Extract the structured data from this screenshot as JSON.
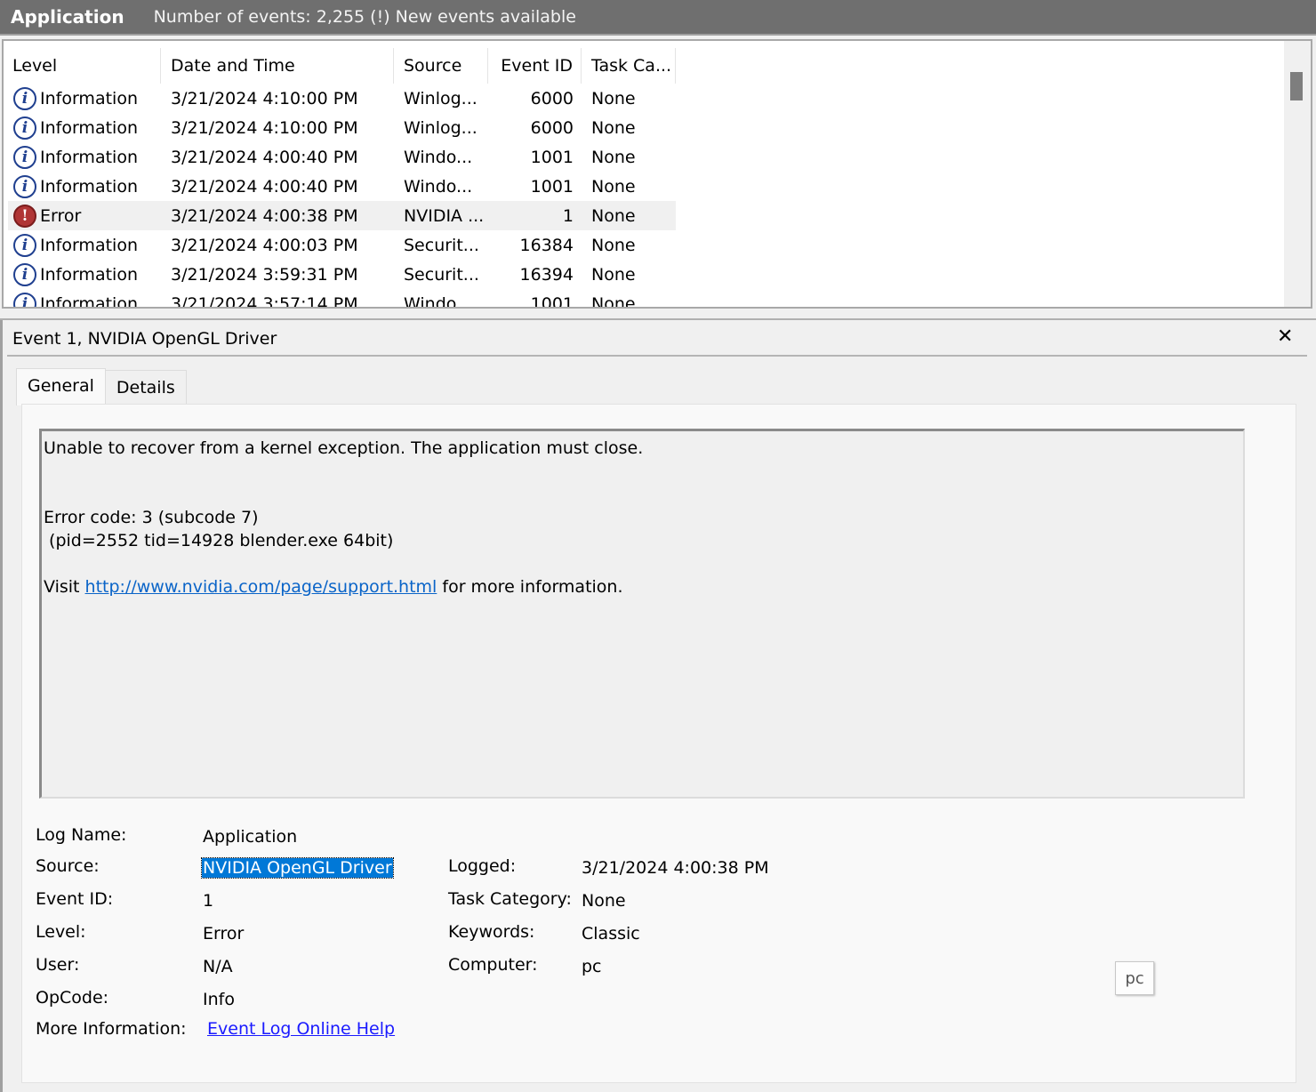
{
  "header": {
    "title": "Application",
    "count_text": "Number of events: 2,255 (!) New events available"
  },
  "event_list": {
    "columns": [
      "Level",
      "Date and Time",
      "Source",
      "Event ID",
      "Task Ca..."
    ],
    "rows": [
      {
        "level": "Information",
        "icon": "information-icon",
        "date": "3/21/2024 4:10:00 PM",
        "source": "Winlog...",
        "event_id": "6000",
        "task": "None"
      },
      {
        "level": "Information",
        "icon": "information-icon",
        "date": "3/21/2024 4:10:00 PM",
        "source": "Winlog...",
        "event_id": "6000",
        "task": "None"
      },
      {
        "level": "Information",
        "icon": "information-icon",
        "date": "3/21/2024 4:00:40 PM",
        "source": "Windo...",
        "event_id": "1001",
        "task": "None"
      },
      {
        "level": "Information",
        "icon": "information-icon",
        "date": "3/21/2024 4:00:40 PM",
        "source": "Windo...",
        "event_id": "1001",
        "task": "None"
      },
      {
        "level": "Error",
        "icon": "error-icon",
        "date": "3/21/2024 4:00:38 PM",
        "source": "NVIDIA ...",
        "event_id": "1",
        "task": "None",
        "selected": true
      },
      {
        "level": "Information",
        "icon": "information-icon",
        "date": "3/21/2024 4:00:03 PM",
        "source": "Securit...",
        "event_id": "16384",
        "task": "None"
      },
      {
        "level": "Information",
        "icon": "information-icon",
        "date": "3/21/2024 3:59:31 PM",
        "source": "Securit...",
        "event_id": "16394",
        "task": "None"
      },
      {
        "level": "Information",
        "icon": "information-icon",
        "date": "3/21/2024 3:57:14 PM",
        "source": "Windo...",
        "event_id": "1001",
        "task": "None"
      }
    ]
  },
  "detail": {
    "title": "Event 1, NVIDIA OpenGL Driver",
    "close_label": "✕",
    "tabs": [
      {
        "label": "General"
      },
      {
        "label": "Details"
      }
    ],
    "message": {
      "line1": "Unable to recover from a kernel exception. The application must close.",
      "line2": "Error code: 3 (subcode 7)",
      "line3": " (pid=2552 tid=14928 blender.exe 64bit)",
      "visit_prefix": "Visit ",
      "link": "http://www.nvidia.com/page/support.html",
      "visit_suffix": " for more information."
    },
    "fields": {
      "log_name_label": "Log Name:",
      "log_name": "Application",
      "source_label": "Source:",
      "source": "NVIDIA OpenGL Driver",
      "logged_label": "Logged:",
      "logged": "3/21/2024 4:00:38 PM",
      "event_id_label": "Event ID:",
      "event_id": "1",
      "task_category_label": "Task Category:",
      "task_category": "None",
      "level_label": "Level:",
      "level": "Error",
      "keywords_label": "Keywords:",
      "keywords": "Classic",
      "user_label": "User:",
      "user": "N/A",
      "computer_label": "Computer:",
      "computer": "pc",
      "opcode_label": "OpCode:",
      "opcode": "Info",
      "more_info_label": "More Information:",
      "more_info_link": "Event Log Online Help"
    },
    "pc_button": "pc"
  }
}
